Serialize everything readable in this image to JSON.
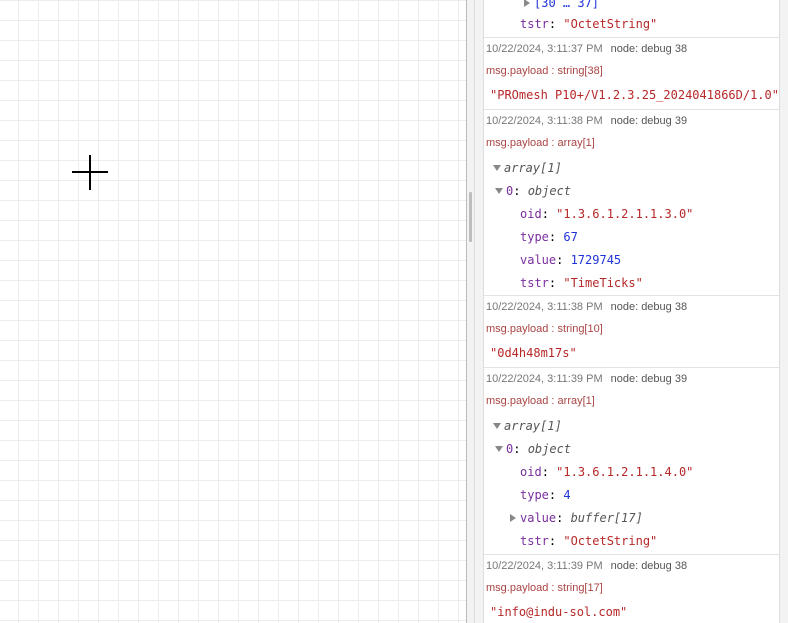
{
  "messages": [
    {
      "partial_top": true,
      "rows": [
        {
          "kind": "collapsed",
          "text": "[30 … 37]"
        },
        {
          "kind": "kv",
          "key": "tstr",
          "value": "\"OctetString\"",
          "vclass": "str"
        }
      ]
    },
    {
      "time": "10/22/2024, 3:11:37 PM",
      "node": "node: debug 38",
      "topic": "msg.payload : string[38]",
      "value": "\"PROmesh P10+/V1.2.3.25_2024041866D/1.0\""
    },
    {
      "time": "10/22/2024, 3:11:38 PM",
      "node": "node: debug 39",
      "topic": "msg.payload : array[1]",
      "array_label": "array[1]",
      "object_key": "0",
      "object_label": "object",
      "fields": [
        {
          "key": "oid",
          "value": "\"1.3.6.1.2.1.1.3.0\"",
          "vclass": "str"
        },
        {
          "key": "type",
          "value": "67",
          "vclass": "num"
        },
        {
          "key": "value",
          "value": "1729745",
          "vclass": "num"
        },
        {
          "key": "tstr",
          "value": "\"TimeTicks\"",
          "vclass": "str"
        }
      ]
    },
    {
      "time": "10/22/2024, 3:11:38 PM",
      "node": "node: debug 38",
      "topic": "msg.payload : string[10]",
      "value": "\"0d4h48m17s\""
    },
    {
      "time": "10/22/2024, 3:11:39 PM",
      "node": "node: debug 39",
      "topic": "msg.payload : array[1]",
      "array_label": "array[1]",
      "object_key": "0",
      "object_label": "object",
      "fields": [
        {
          "key": "oid",
          "value": "\"1.3.6.1.2.1.1.4.0\"",
          "vclass": "str"
        },
        {
          "key": "type",
          "value": "4",
          "vclass": "num"
        },
        {
          "key": "value",
          "value": "buffer[17]",
          "vclass": "typ",
          "collapsed": true
        },
        {
          "key": "tstr",
          "value": "\"OctetString\"",
          "vclass": "str"
        }
      ]
    },
    {
      "time": "10/22/2024, 3:11:39 PM",
      "node": "node: debug 38",
      "topic": "msg.payload : string[17]",
      "value": "\"info@indu-sol.com\""
    }
  ]
}
